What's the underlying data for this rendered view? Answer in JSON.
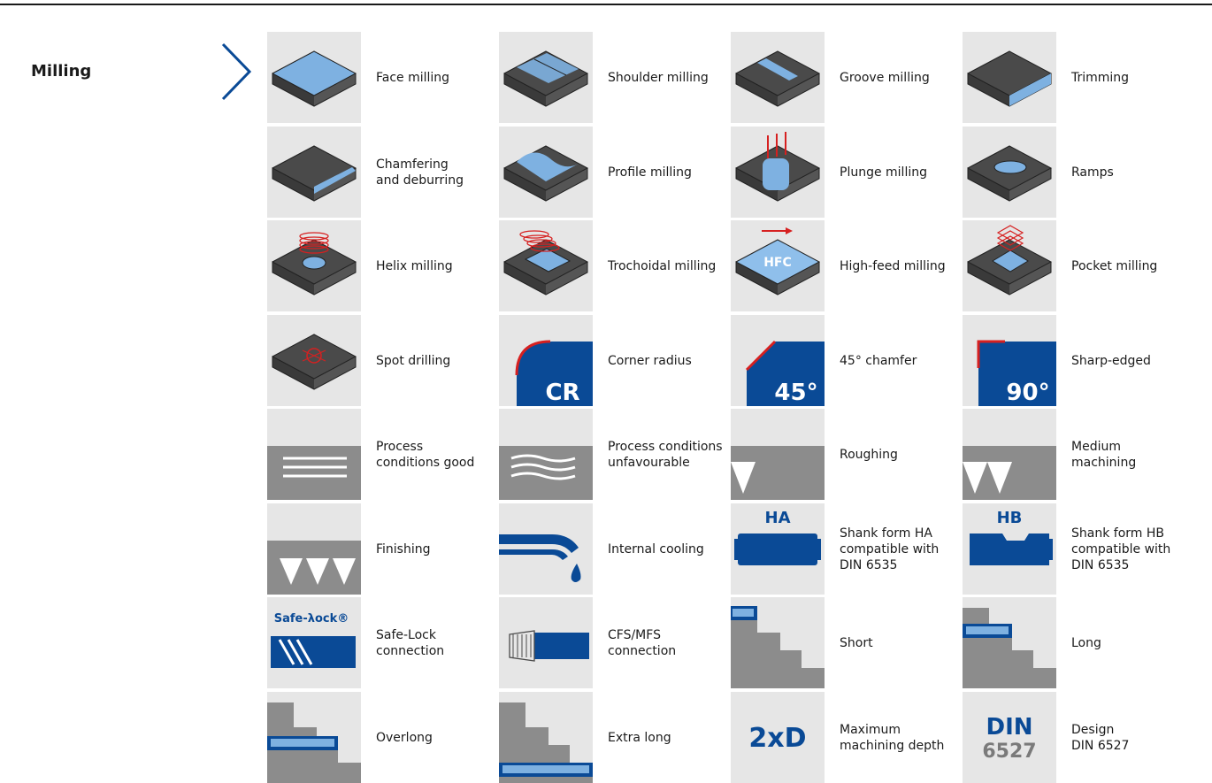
{
  "section": {
    "title": "Milling"
  },
  "tiles": [
    {
      "label": "Face milling",
      "icon": "face-milling-icon"
    },
    {
      "label": "Shoulder milling",
      "icon": "shoulder-milling-icon"
    },
    {
      "label": "Groove milling",
      "icon": "groove-milling-icon"
    },
    {
      "label": "Trimming",
      "icon": "trimming-icon"
    },
    {
      "label": "Chamfering\nand deburring",
      "icon": "chamfering-icon"
    },
    {
      "label": "Profile milling",
      "icon": "profile-milling-icon"
    },
    {
      "label": "Plunge milling",
      "icon": "plunge-milling-icon"
    },
    {
      "label": "Ramps",
      "icon": "ramps-icon"
    },
    {
      "label": "Helix milling",
      "icon": "helix-milling-icon"
    },
    {
      "label": "Trochoidal milling",
      "icon": "trochoidal-milling-icon"
    },
    {
      "label": "High-feed milling",
      "icon": "high-feed-milling-icon",
      "icon_text": "HFC"
    },
    {
      "label": "Pocket milling",
      "icon": "pocket-milling-icon"
    },
    {
      "label": "Spot drilling",
      "icon": "spot-drilling-icon"
    },
    {
      "label": "Corner radius",
      "icon": "corner-radius-icon",
      "icon_text": "CR"
    },
    {
      "label": "45° chamfer",
      "icon": "chamfer-45-icon",
      "icon_text": "45°"
    },
    {
      "label": "Sharp-edged",
      "icon": "sharp-edged-icon",
      "icon_text": "90°"
    },
    {
      "label": "Process\nconditions good",
      "icon": "conditions-good-icon"
    },
    {
      "label": "Process conditions\nunfavourable",
      "icon": "conditions-unfavourable-icon"
    },
    {
      "label": "Roughing",
      "icon": "roughing-icon"
    },
    {
      "label": "Medium\nmachining",
      "icon": "medium-machining-icon"
    },
    {
      "label": "Finishing",
      "icon": "finishing-icon"
    },
    {
      "label": "Internal cooling",
      "icon": "internal-cooling-icon"
    },
    {
      "label": "Shank form HA\ncompatible with\nDIN 6535",
      "icon": "shank-ha-icon",
      "icon_text": "HA"
    },
    {
      "label": "Shank form HB\ncompatible with\nDIN 6535",
      "icon": "shank-hb-icon",
      "icon_text": "HB"
    },
    {
      "label": "Safe-Lock\nconnection",
      "icon": "safe-lock-icon",
      "icon_text": "Safe-λock®"
    },
    {
      "label": "CFS/MFS\nconnection",
      "icon": "cfs-mfs-icon"
    },
    {
      "label": "Short",
      "icon": "length-short-icon"
    },
    {
      "label": "Long",
      "icon": "length-long-icon"
    },
    {
      "label": "Overlong",
      "icon": "length-overlong-icon"
    },
    {
      "label": "Extra long",
      "icon": "length-extra-long-icon"
    },
    {
      "label": "Maximum\nmachining depth",
      "icon": "max-depth-icon",
      "icon_text": "2xD"
    },
    {
      "label": "Design\nDIN 6527",
      "icon": "din-6527-icon",
      "icon_text": "DIN\n6527"
    }
  ],
  "colors": {
    "blue": "#0a4a96",
    "light_blue": "#7eb1e1",
    "dark": "#4a4a4a",
    "grey": "#8c8c8c",
    "tile": "#e6e6e6",
    "red": "#d62020"
  }
}
